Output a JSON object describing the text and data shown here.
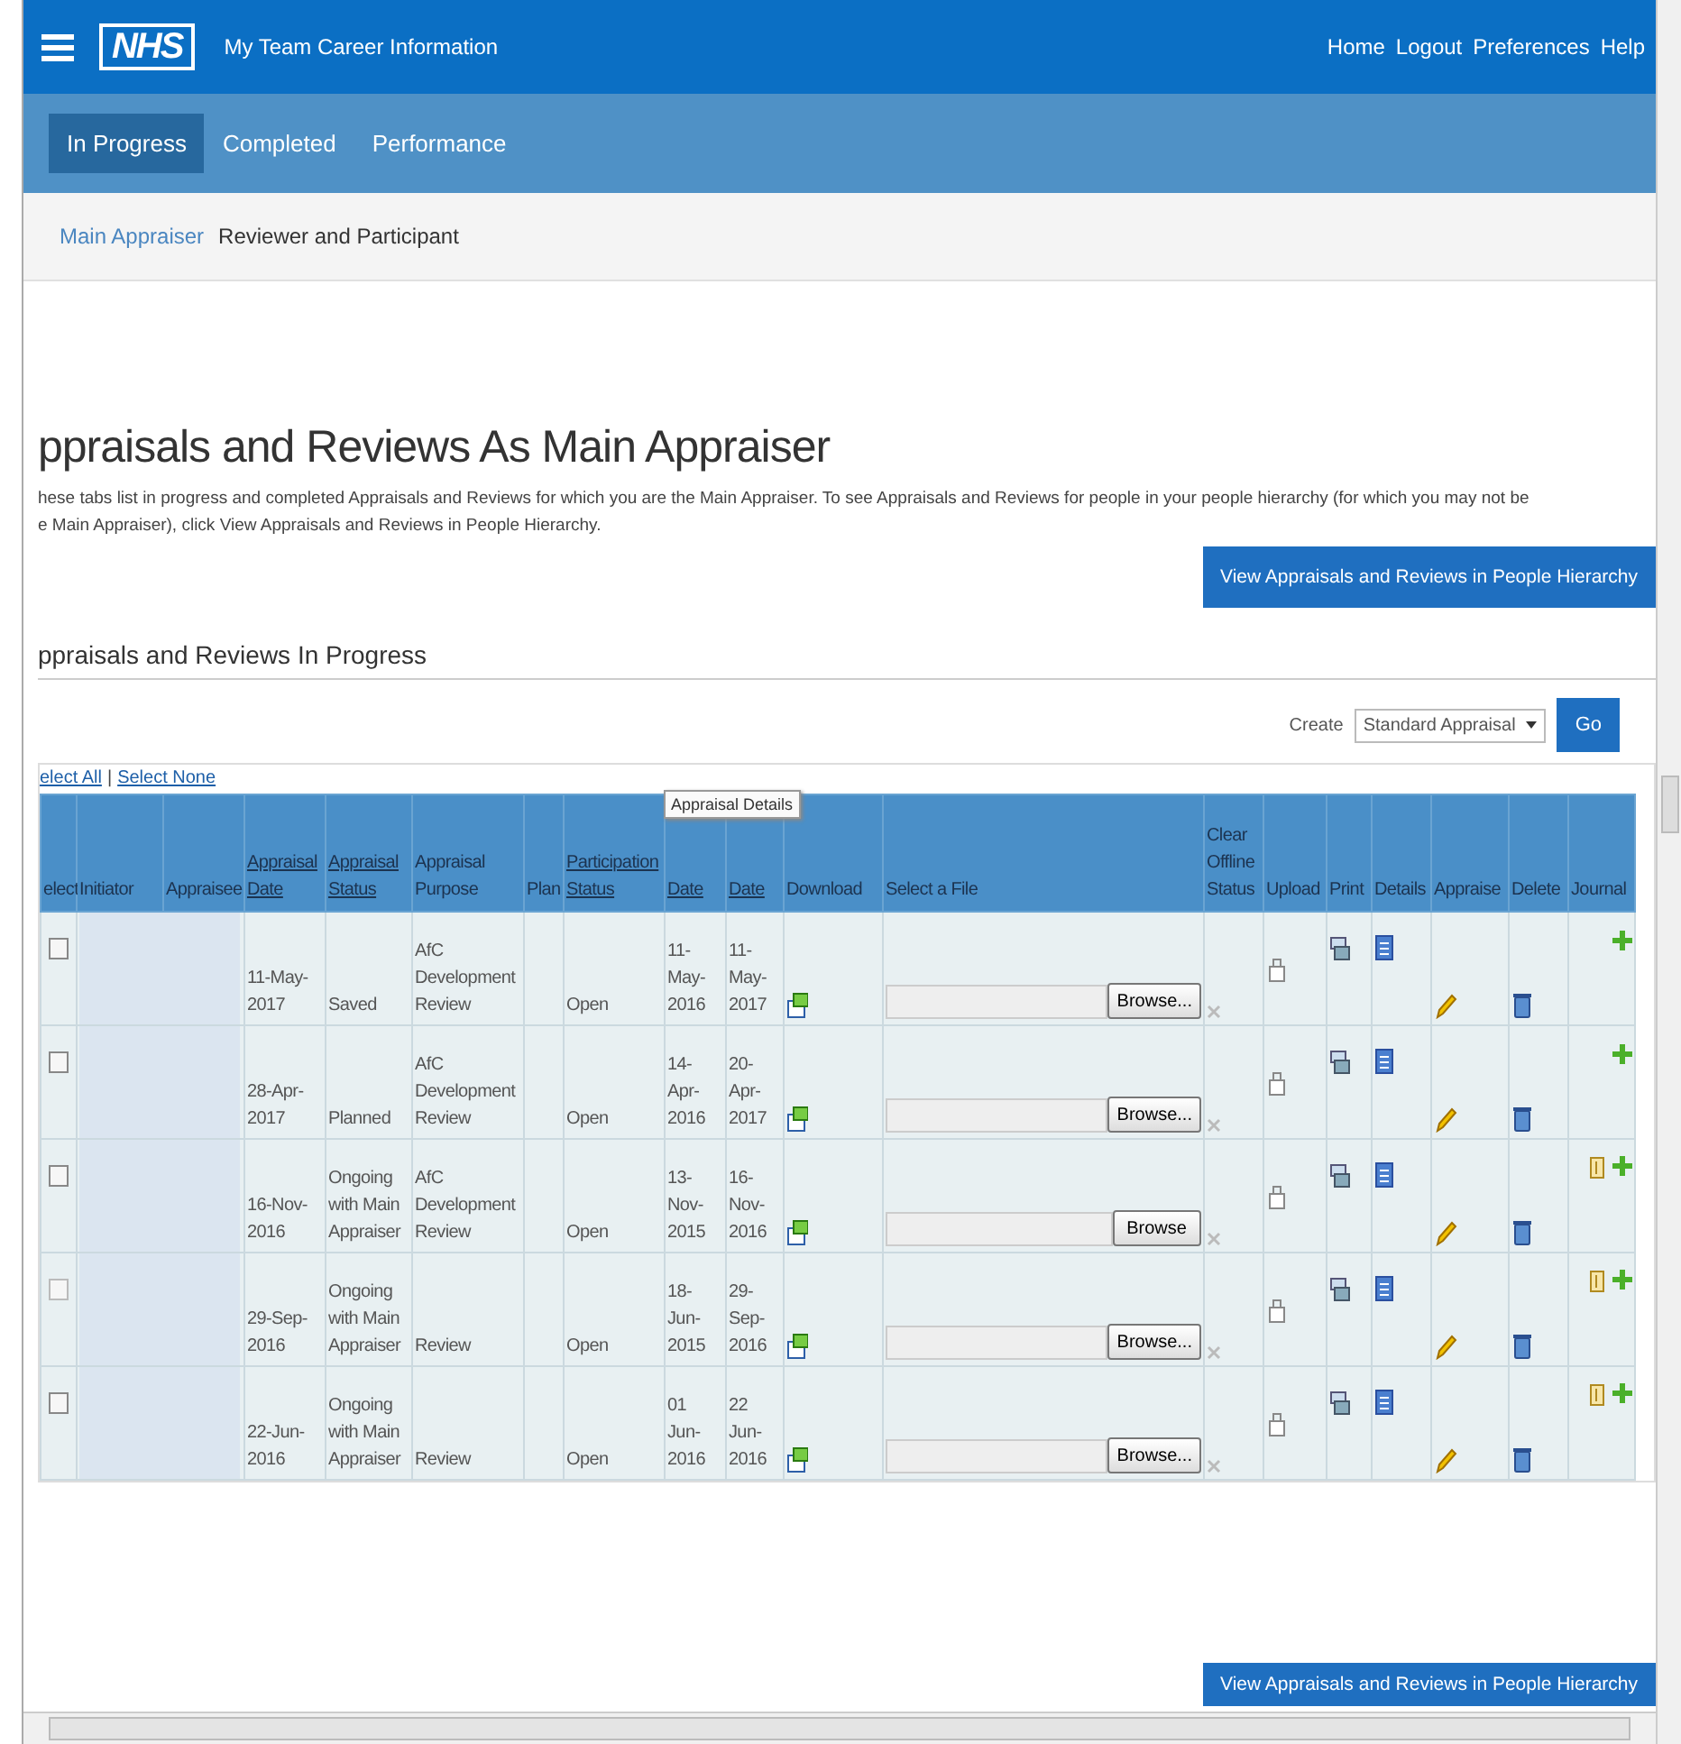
{
  "header": {
    "logo": "NHS",
    "title": "My Team Career Information",
    "links": [
      "Home",
      "Logout",
      "Preferences",
      "Help"
    ]
  },
  "tabs": [
    {
      "label": "In Progress",
      "selected": true
    },
    {
      "label": "Completed",
      "selected": false
    },
    {
      "label": "Performance",
      "selected": false
    }
  ],
  "subtabs": [
    {
      "label": "Main Appraiser",
      "selected": true
    },
    {
      "label": "Reviewer and Participant",
      "selected": false
    }
  ],
  "page": {
    "title": "ppraisals and Reviews As Main Appraiser",
    "description_lines": [
      "hese tabs list in progress and completed Appraisals and Reviews for which you are the Main Appraiser. To see Appraisals and Reviews for people in your people hierarchy (for which you may not be",
      "e Main Appraiser), click View Appraisals and Reviews in People Hierarchy."
    ],
    "hierarchy_button": "View Appraisals and Reviews in People Hierarchy"
  },
  "section": {
    "title": "ppraisals and Reviews In Progress",
    "create_label": "Create",
    "create_value": "Standard Appraisal",
    "go_button": "Go",
    "select_links": [
      "elect All",
      "Select None"
    ],
    "link_separator": "|"
  },
  "tooltip": "Appraisal Details",
  "table": {
    "columns": [
      {
        "label": "elect",
        "sortable": false
      },
      {
        "label": "Initiator",
        "sortable": false
      },
      {
        "label": "Appraisee",
        "sortable": false
      },
      {
        "label": "Appraisal Date",
        "sortable": true
      },
      {
        "label": "Appraisal Status",
        "sortable": true
      },
      {
        "label": "Appraisal Purpose",
        "sortable": false
      },
      {
        "label": "Plan",
        "sortable": false
      },
      {
        "label": "Participation Status",
        "sortable": true
      },
      {
        "label": "Date",
        "sortable": true
      },
      {
        "label": "Date",
        "sortable": true
      },
      {
        "label": "Download",
        "sortable": false
      },
      {
        "label": "Select a File",
        "sortable": false
      },
      {
        "label": "Clear Offline Status",
        "sortable": false
      },
      {
        "label": "Upload",
        "sortable": false
      },
      {
        "label": "Print",
        "sortable": false
      },
      {
        "label": "Details",
        "sortable": false
      },
      {
        "label": "Appraise",
        "sortable": false
      },
      {
        "label": "Delete",
        "sortable": false
      },
      {
        "label": "Journal",
        "sortable": false
      }
    ],
    "rows": [
      {
        "checked": false,
        "disabled": false,
        "date": "11-May-2017",
        "status": "Saved",
        "purpose": "AfC Development Review",
        "participation": "Open",
        "start": "11-May-2016",
        "end": "11-May-2017",
        "browse": "Browse...",
        "has_journal": false
      },
      {
        "checked": false,
        "disabled": false,
        "date": "28-Apr-2017",
        "status": "Planned",
        "purpose": "AfC Development Review",
        "participation": "Open",
        "start": "14-Apr-2016",
        "end": "20-Apr-2017",
        "browse": "Browse...",
        "has_journal": false
      },
      {
        "checked": false,
        "disabled": false,
        "date": "16-Nov-2016",
        "status": "Ongoing with Main Appraiser",
        "purpose": "AfC Development Review",
        "participation": "Open",
        "start": "13-Nov-2015",
        "end": "16-Nov-2016",
        "browse": "Browse",
        "has_journal": true
      },
      {
        "checked": false,
        "disabled": true,
        "date": "29-Sep-2016",
        "status": "Ongoing with Main Appraiser",
        "purpose": "Review",
        "participation": "Open",
        "start": "18-Jun-2015",
        "end": "29-Sep-2016",
        "browse": "Browse...",
        "has_journal": true
      },
      {
        "checked": false,
        "disabled": false,
        "date": "22-Jun-2016",
        "status": "Ongoing with Main Appraiser",
        "purpose": "Review",
        "participation": "Open",
        "start": "01 Jun-2016",
        "end": "22 Jun-2016",
        "browse": "Browse...",
        "has_journal": true
      }
    ]
  },
  "bottom_button": "View Appraisals and Reviews in People Hierarchy"
}
